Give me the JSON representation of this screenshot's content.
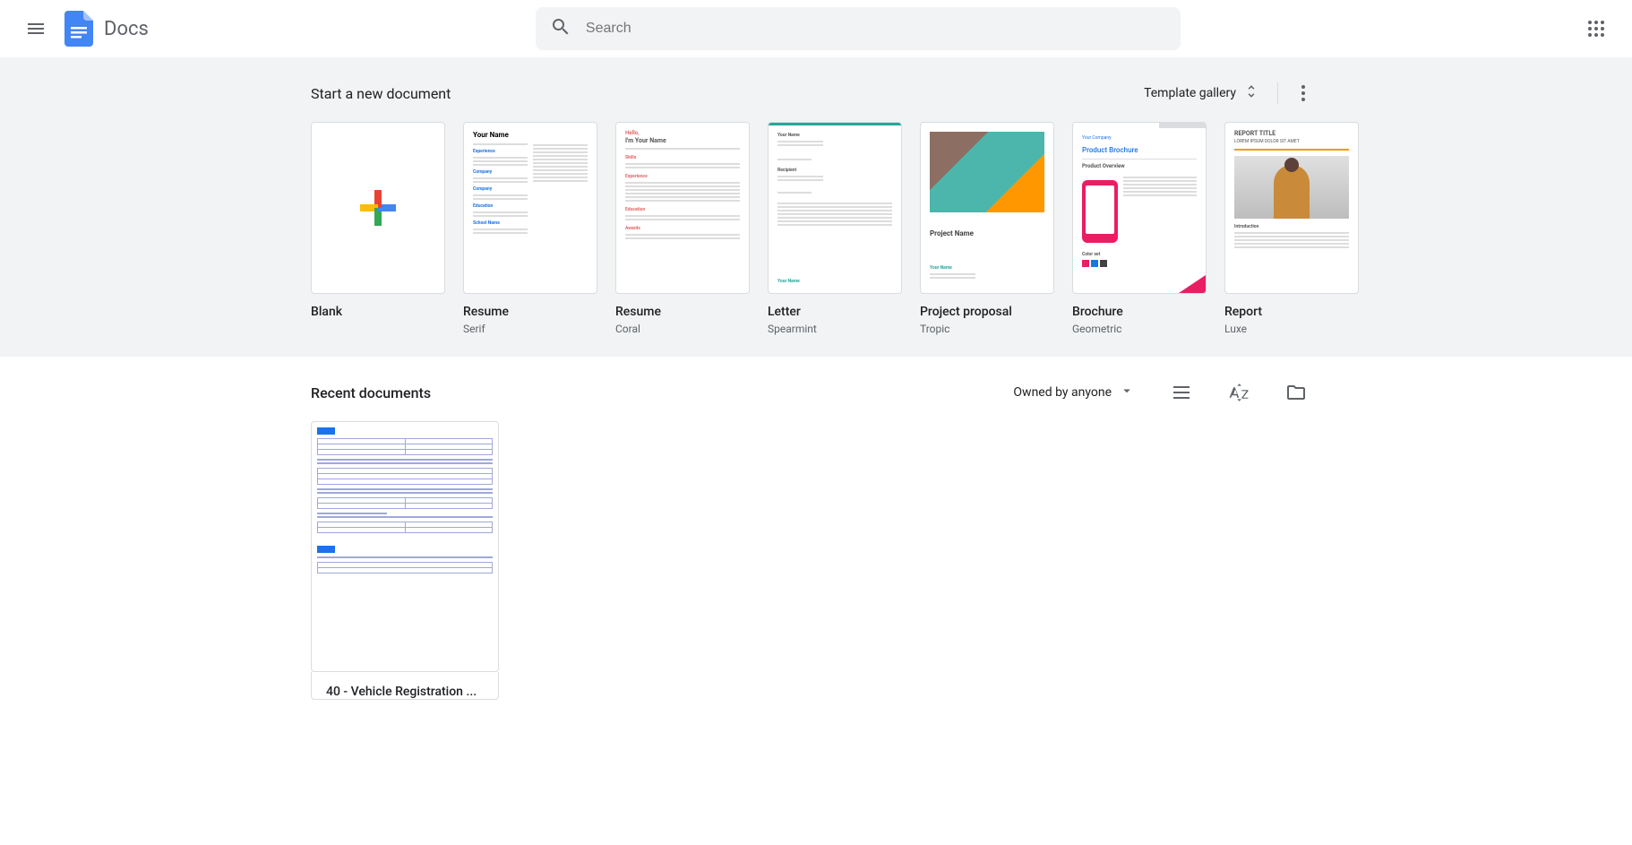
{
  "header": {
    "app_name": "Docs",
    "search_placeholder": "Search"
  },
  "templates": {
    "section_title": "Start a new document",
    "gallery_label": "Template gallery",
    "items": [
      {
        "title": "Blank",
        "subtitle": ""
      },
      {
        "title": "Resume",
        "subtitle": "Serif"
      },
      {
        "title": "Resume",
        "subtitle": "Coral"
      },
      {
        "title": "Letter",
        "subtitle": "Spearmint"
      },
      {
        "title": "Project proposal",
        "subtitle": "Tropic"
      },
      {
        "title": "Brochure",
        "subtitle": "Geometric"
      },
      {
        "title": "Report",
        "subtitle": "Luxe"
      }
    ]
  },
  "recent": {
    "section_title": "Recent documents",
    "owned_filter": "Owned by anyone",
    "documents": [
      {
        "title": "40 - Vehicle Registration ..."
      }
    ]
  }
}
